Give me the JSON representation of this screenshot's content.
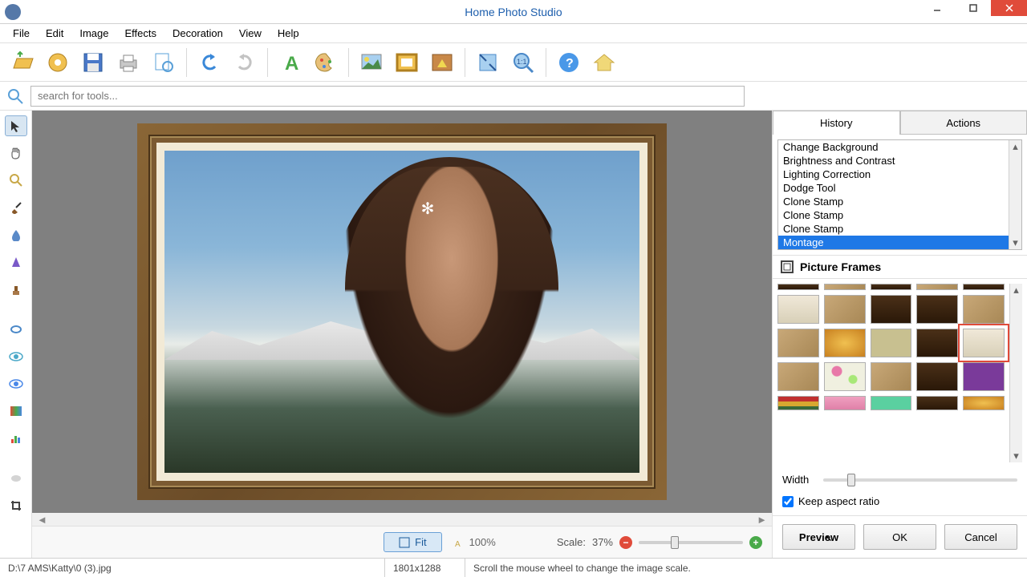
{
  "app": {
    "title": "Home Photo Studio"
  },
  "menu": [
    "File",
    "Edit",
    "Image",
    "Effects",
    "Decoration",
    "View",
    "Help"
  ],
  "search": {
    "placeholder": "search for tools..."
  },
  "history": {
    "tab_history": "History",
    "tab_actions": "Actions",
    "items": [
      "Change Background",
      "Brightness and Contrast",
      "Lighting Correction",
      "Dodge Tool",
      "Clone Stamp",
      "Clone Stamp",
      "Clone Stamp",
      "Montage"
    ],
    "selected_index": 7
  },
  "frames": {
    "title": "Picture Frames",
    "width_label": "Width",
    "keep_label": "Keep aspect ratio",
    "keep_checked": true
  },
  "buttons": {
    "preview": "Preview",
    "ok": "OK",
    "cancel": "Cancel"
  },
  "zoom": {
    "fit": "Fit",
    "hundred": "100%",
    "scale_label": "Scale:",
    "scale_value": "37%"
  },
  "status": {
    "path": "D:\\7 AMS\\Katty\\0 (3).jpg",
    "dimensions": "1801x1288",
    "hint": "Scroll the mouse wheel to change the image scale."
  }
}
